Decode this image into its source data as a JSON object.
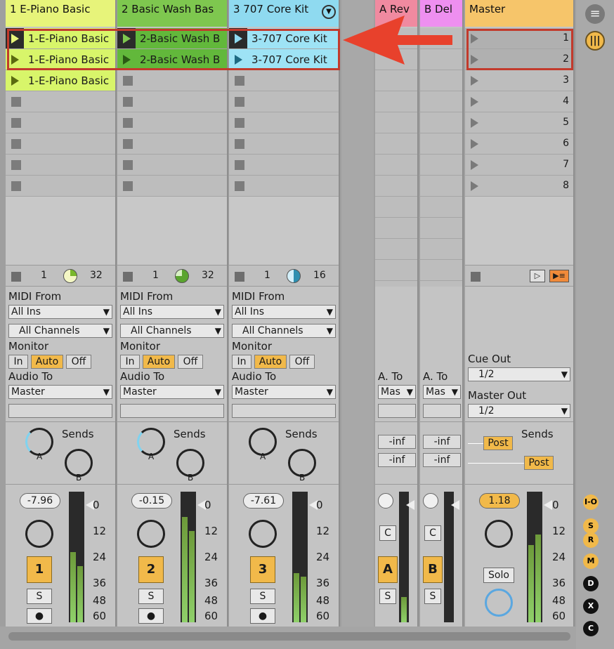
{
  "tracks": [
    {
      "name": "1 E-Piano Basic",
      "color": "#e7f47a",
      "clip_color": "#d8f56a",
      "clip_label": "1-E-Piano Basic",
      "counter": "1",
      "length": "32",
      "midi_from_label": "MIDI From",
      "midi_from": "All Ins",
      "channels": "All Channels",
      "monitor_label": "Monitor",
      "monitor": [
        "In",
        "Auto",
        "Off"
      ],
      "audio_to_label": "Audio To",
      "audio_to": "Master",
      "sends_label": "Sends",
      "send_a": "A",
      "send_b": "B",
      "volume": "-7.96",
      "track_number": "1",
      "solo": "S"
    },
    {
      "name": "2 Basic Wash Bas",
      "color": "#7ec74f",
      "clip_color": "#62b83b",
      "clip_label": "2-Basic Wash B",
      "counter": "1",
      "length": "32",
      "midi_from_label": "MIDI From",
      "midi_from": "All Ins",
      "channels": "All Channels",
      "monitor_label": "Monitor",
      "monitor": [
        "In",
        "Auto",
        "Off"
      ],
      "audio_to_label": "Audio To",
      "audio_to": "Master",
      "sends_label": "Sends",
      "send_a": "A",
      "send_b": "B",
      "volume": "-0.15",
      "track_number": "2",
      "solo": "S"
    },
    {
      "name": "3 707 Core Kit",
      "color": "#8fdaf0",
      "clip_color": "#9ee3f5",
      "clip_label": "3-707 Core Kit",
      "counter": "1",
      "length": "16",
      "midi_from_label": "MIDI From",
      "midi_from": "All Ins",
      "channels": "All Channels",
      "monitor_label": "Monitor",
      "monitor": [
        "In",
        "Auto",
        "Off"
      ],
      "audio_to_label": "Audio To",
      "audio_to": "Master",
      "sends_label": "Sends",
      "send_a": "A",
      "send_b": "B",
      "volume": "-7.61",
      "track_number": "3",
      "solo": "S"
    }
  ],
  "returns": [
    {
      "name": "A Rev",
      "color": "#f08aa0",
      "to_label": "A. To",
      "to": "Mas",
      "send_value": "-inf",
      "letter": "A",
      "c_label": "C",
      "solo": "S"
    },
    {
      "name": "B Del",
      "color": "#ee8ff0",
      "to_label": "A. To",
      "to": "Mas",
      "send_value": "-inf",
      "letter": "B",
      "c_label": "C",
      "solo": "S"
    }
  ],
  "master": {
    "name": "Master",
    "color": "#f6c56a",
    "scenes": [
      "1",
      "2",
      "3",
      "4",
      "5",
      "6",
      "7",
      "8"
    ],
    "cue_out_label": "Cue Out",
    "cue_out": "1/2",
    "master_out_label": "Master Out",
    "master_out": "1/2",
    "sends_label": "Sends",
    "post_label": "Post",
    "volume": "1.18",
    "solo_label": "Solo"
  },
  "meter_scale": [
    "0",
    "12",
    "24",
    "36",
    "48",
    "60"
  ],
  "side_buttons": [
    "I-O",
    "S",
    "R",
    "M",
    "D",
    "X",
    "C"
  ],
  "annotation_color": "#e8412c"
}
